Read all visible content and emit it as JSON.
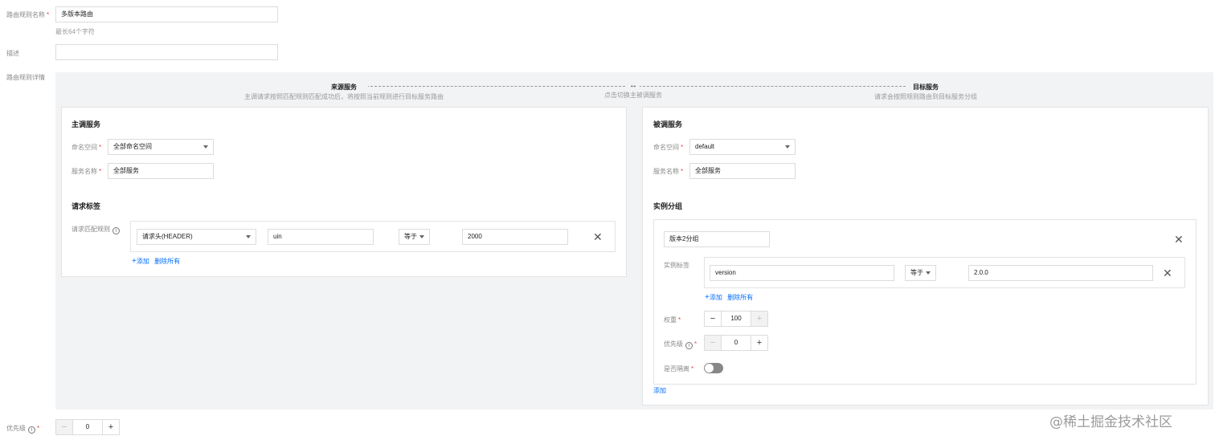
{
  "rule_name": {
    "label": "路由规则名称",
    "required_mark": "*",
    "value": "多版本路由",
    "hint": "最长64个字符"
  },
  "description": {
    "label": "描述",
    "value": ""
  },
  "rule_details": {
    "label": "路由规则详情"
  },
  "flow": {
    "source_title": "来源服务",
    "source_desc": "主调请求按照匹配规则匹配成功后，将按照当前规则进行目标服务路由",
    "switch_symbol": "↔",
    "switch_label": "点击切换主被调服务",
    "target_title": "目标服务",
    "target_desc": "请求会按照规则路由到目标服务分组"
  },
  "caller": {
    "title": "主调服务",
    "namespace_label": "命名空间",
    "namespace_value": "全部命名空间",
    "service_label": "服务名称",
    "service_value": "全部服务",
    "tags_title": "请求标签",
    "match_label": "请求匹配规则",
    "rule": {
      "type": "请求头(HEADER)",
      "key": "uin",
      "operator": "等于",
      "value": "2000"
    },
    "add_label": "添加",
    "delete_all_label": "删除所有"
  },
  "callee": {
    "title": "被调服务",
    "namespace_label": "命名空间",
    "namespace_value": "default",
    "service_label": "服务名称",
    "service_value": "全部服务",
    "groups_title": "实例分组",
    "group": {
      "name": "版本2分组",
      "tags_label": "实例标签",
      "tag": {
        "key": "version",
        "operator": "等于",
        "value": "2.0.0"
      },
      "add_label": "添加",
      "delete_all_label": "删除所有",
      "weight_label": "权重",
      "weight_value": "100",
      "priority_label": "优先级",
      "priority_value": "0",
      "isolate_label": "是否隔离",
      "isolated": false
    },
    "add_group_label": "添加"
  },
  "priority": {
    "label": "优先级",
    "required_mark": "*",
    "value": "0"
  },
  "watermark": "@稀土掘金技术社区",
  "colors": {
    "link": "#006eff",
    "required": "#e54545",
    "panel_bg": "#f2f3f5"
  }
}
